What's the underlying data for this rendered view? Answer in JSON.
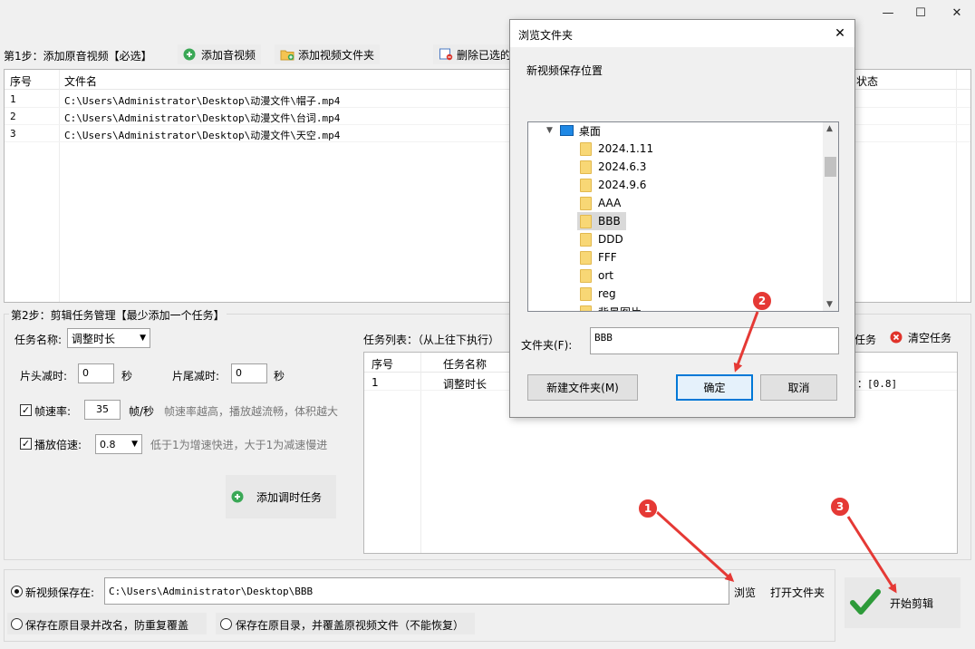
{
  "window": {
    "minimize": "—",
    "maximize": "☐",
    "close": "✕"
  },
  "step1": {
    "title": "第1步：添加原音视频【必选】",
    "add_audio_video": "添加音视频",
    "add_video_folder": "添加视频文件夹",
    "delete_selected": "删除已选的"
  },
  "file_table": {
    "headers": {
      "index": "序号",
      "filename": "文件名",
      "status": "状态"
    },
    "rows": [
      {
        "index": "1",
        "filename": "C:\\Users\\Administrator\\Desktop\\动漫文件\\帽子.mp4"
      },
      {
        "index": "2",
        "filename": "C:\\Users\\Administrator\\Desktop\\动漫文件\\台词.mp4"
      },
      {
        "index": "3",
        "filename": "C:\\Users\\Administrator\\Desktop\\动漫文件\\天空.mp4"
      }
    ]
  },
  "step2": {
    "title": "第2步：剪辑任务管理【最少添加一个任务】",
    "task_name_label": "任务名称:",
    "task_name_value": "调整时长",
    "head_cut_label": "片头减时:",
    "head_cut_value": "0",
    "head_cut_unit": "秒",
    "tail_cut_label": "片尾减时:",
    "tail_cut_value": "0",
    "tail_cut_unit": "秒",
    "framerate_label": "帧速率:",
    "framerate_value": "35",
    "framerate_unit": "帧/秒",
    "framerate_hint": "帧速率越高，播放越流畅，体积越大",
    "speed_label": "播放倍速:",
    "speed_value": "0.8",
    "speed_hint": "低于1为增速快进，大于1为减速慢进",
    "add_task_button": "添加调时任务",
    "task_list_label": "任务列表：（从上往下执行）",
    "task_button_partial": "任务",
    "clear_tasks": "清空任务",
    "task_table": {
      "headers": {
        "index": "序号",
        "name": "任务名称"
      },
      "rows": [
        {
          "index": "1",
          "name": "调整时长",
          "params": "：[0.8]"
        }
      ]
    }
  },
  "output": {
    "save_to_label": "新视频保存在:",
    "save_path": "C:\\Users\\Administrator\\Desktop\\BBB",
    "browse": "浏览",
    "open_folder": "打开文件夹",
    "rename_option": "保存在原目录并改名，防重复覆盖",
    "overwrite_option": "保存在原目录，并覆盖原视频文件（不能恢复）",
    "start_button": "开始剪辑"
  },
  "dialog": {
    "title": "浏览文件夹",
    "close": "✕",
    "description": "新视频保存位置",
    "tree": {
      "root": "桌面",
      "items": [
        "2024.1.11",
        "2024.6.3",
        "2024.9.6",
        "AAA",
        "BBB",
        "DDD",
        "FFF",
        "ort",
        "reg",
        "背景图片"
      ]
    },
    "folder_label": "文件夹(F):",
    "folder_value": "BBB",
    "new_folder": "新建文件夹(M)",
    "ok": "确定",
    "cancel": "取消"
  },
  "annotations": {
    "badge1": "1",
    "badge2": "2",
    "badge3": "3"
  },
  "colors": {
    "accent": "#0078d7",
    "annotation_red": "#e53935",
    "selection": "#cce8ff"
  }
}
